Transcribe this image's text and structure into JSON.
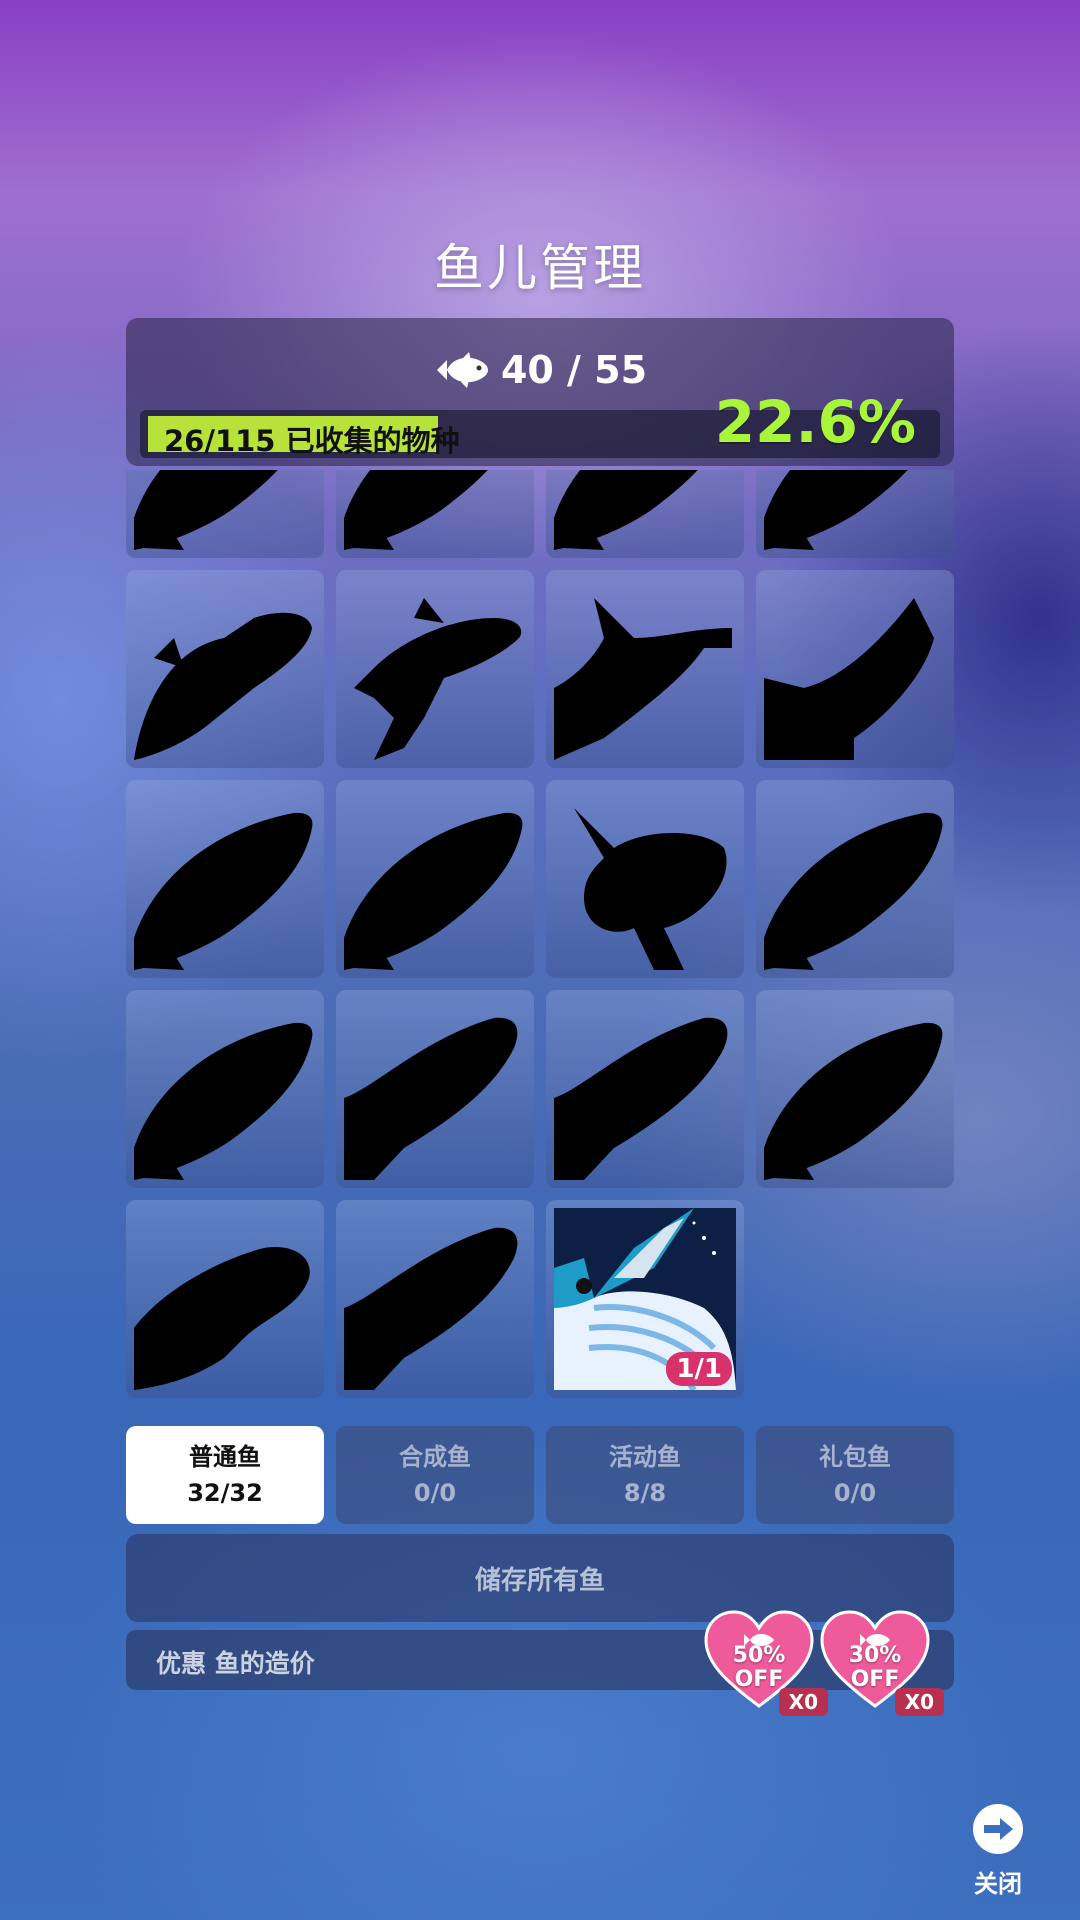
{
  "title": "鱼儿管理",
  "capacity": {
    "current": "40",
    "separator": "/",
    "max": "55",
    "text": "40 / 55"
  },
  "collection": {
    "label": "26/115 已收集的物种",
    "percent_text": "22.6%",
    "progress": 0.226
  },
  "grid": {
    "cells": [
      {
        "type": "silhouette",
        "icon": "fish-silhouette-icon"
      },
      {
        "type": "silhouette",
        "icon": "fish-silhouette-icon"
      },
      {
        "type": "silhouette",
        "icon": "fish-silhouette-icon"
      },
      {
        "type": "silhouette",
        "icon": "fish-silhouette-icon"
      },
      {
        "type": "silhouette",
        "icon": "shark-silhouette-icon"
      },
      {
        "type": "silhouette",
        "icon": "orca-silhouette-icon"
      },
      {
        "type": "silhouette",
        "icon": "hammerhead-silhouette-icon"
      },
      {
        "type": "silhouette",
        "icon": "manta-silhouette-icon"
      },
      {
        "type": "silhouette",
        "icon": "fish-silhouette-icon"
      },
      {
        "type": "silhouette",
        "icon": "fish-silhouette-icon"
      },
      {
        "type": "silhouette",
        "icon": "sunfish-silhouette-icon"
      },
      {
        "type": "silhouette",
        "icon": "fish-silhouette-icon"
      },
      {
        "type": "silhouette",
        "icon": "fish-silhouette-icon"
      },
      {
        "type": "silhouette",
        "icon": "whale-silhouette-icon"
      },
      {
        "type": "silhouette",
        "icon": "whale-silhouette-icon"
      },
      {
        "type": "silhouette",
        "icon": "fish-silhouette-icon"
      },
      {
        "type": "silhouette",
        "icon": "beluga-silhouette-icon"
      },
      {
        "type": "silhouette",
        "icon": "whale-silhouette-icon"
      },
      {
        "type": "collected",
        "icon": "blue-whale-icon",
        "badge": "1/1"
      }
    ]
  },
  "tabs": [
    {
      "label": "普通鱼",
      "count": "32/32",
      "active": true
    },
    {
      "label": "合成鱼",
      "count": "0/0",
      "active": false
    },
    {
      "label": "活动鱼",
      "count": "8/8",
      "active": false
    },
    {
      "label": "礼包鱼",
      "count": "0/0",
      "active": false
    }
  ],
  "store_button": "储存所有鱼",
  "discount": {
    "label": "优惠 鱼的造价",
    "coupons": [
      {
        "percent": "50%",
        "off": "OFF",
        "qty": "X0",
        "color": "#ef5a9a"
      },
      {
        "percent": "30%",
        "off": "OFF",
        "qty": "X0",
        "color": "#ef5a9a"
      }
    ]
  },
  "close": {
    "label": "关闭",
    "icon": "arrow-right-icon"
  }
}
